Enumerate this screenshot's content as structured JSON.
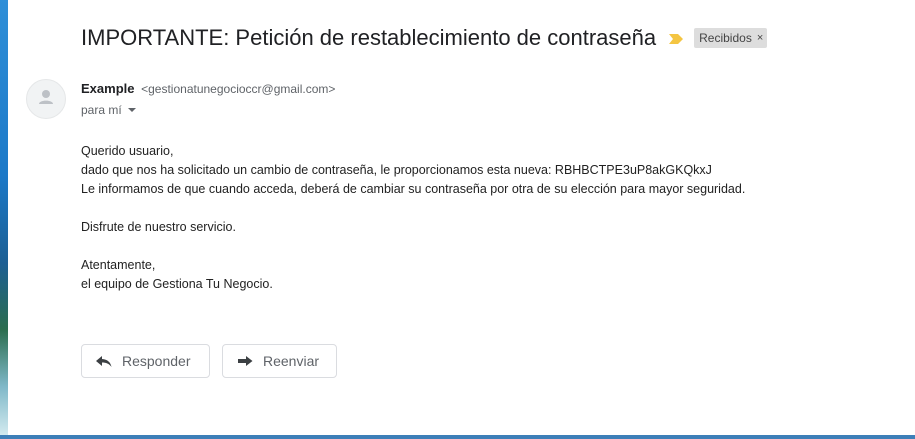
{
  "email": {
    "subject": "IMPORTANTE: Petición de restablecimiento de contraseña",
    "label": "Recibidos",
    "label_close": "×",
    "sender_name": "Example",
    "sender_email": "<gestionatunegocioccr@gmail.com>",
    "recipient_text": "para mí",
    "body_lines": [
      "Querido usuario,",
      "dado que nos ha solicitado un cambio de contraseña, le proporcionamos esta nueva: RBHBCTPE3uP8akGKQkxJ",
      "Le informamos de que cuando acceda, deberá de cambiar su contraseña por otra de su elección para mayor seguridad.",
      "",
      "Disfrute de nuestro servicio.",
      "",
      "Atentamente,",
      "el equipo de Gestiona Tu Negocio."
    ]
  },
  "actions": {
    "reply_label": "Responder",
    "forward_label": "Reenviar"
  },
  "colors": {
    "importance_marker": "#f4c542",
    "label_bg": "#dddddd",
    "text_primary": "#202124",
    "text_secondary": "#5f6368"
  },
  "icons": {
    "importance": "importance-marker-icon",
    "avatar": "person-icon",
    "reply": "reply-arrow-icon",
    "forward": "forward-arrow-icon",
    "dropdown": "caret-down-icon"
  }
}
